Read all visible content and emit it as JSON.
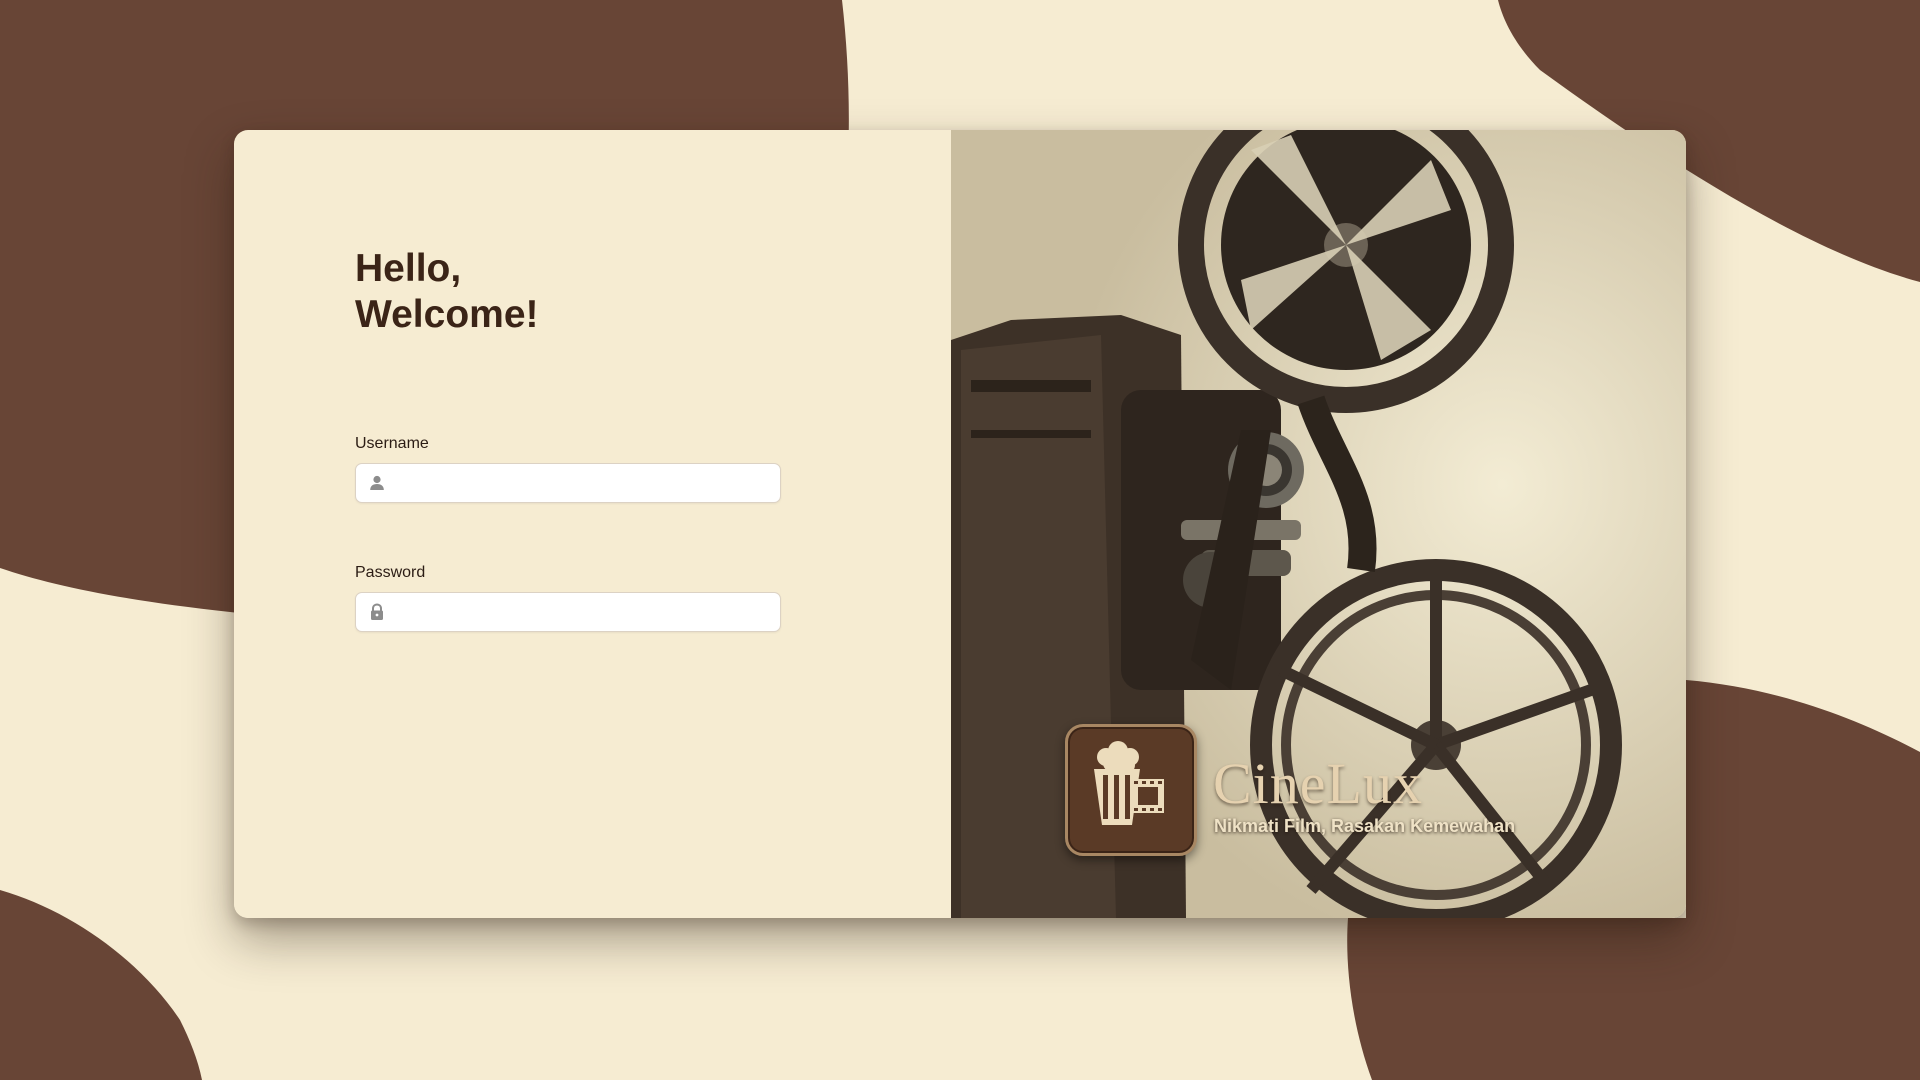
{
  "colors": {
    "page_background": "#f6ecd2",
    "blob_brown": "#684536",
    "heading_text": "#3b2417",
    "brand_text": "#e6d2b0"
  },
  "login": {
    "greeting_line1": "Hello,",
    "greeting_line2": "Welcome!",
    "username": {
      "label": "Username",
      "value": "",
      "placeholder": "",
      "icon": "user-icon"
    },
    "password": {
      "label": "Password",
      "value": "",
      "placeholder": "",
      "icon": "lock-icon"
    }
  },
  "brand": {
    "name": "CineLux",
    "tagline": "Nikmati Film, Rasakan Kemewahan",
    "logo_icon": "popcorn-film-icon",
    "hero_image": "vintage film projector"
  }
}
